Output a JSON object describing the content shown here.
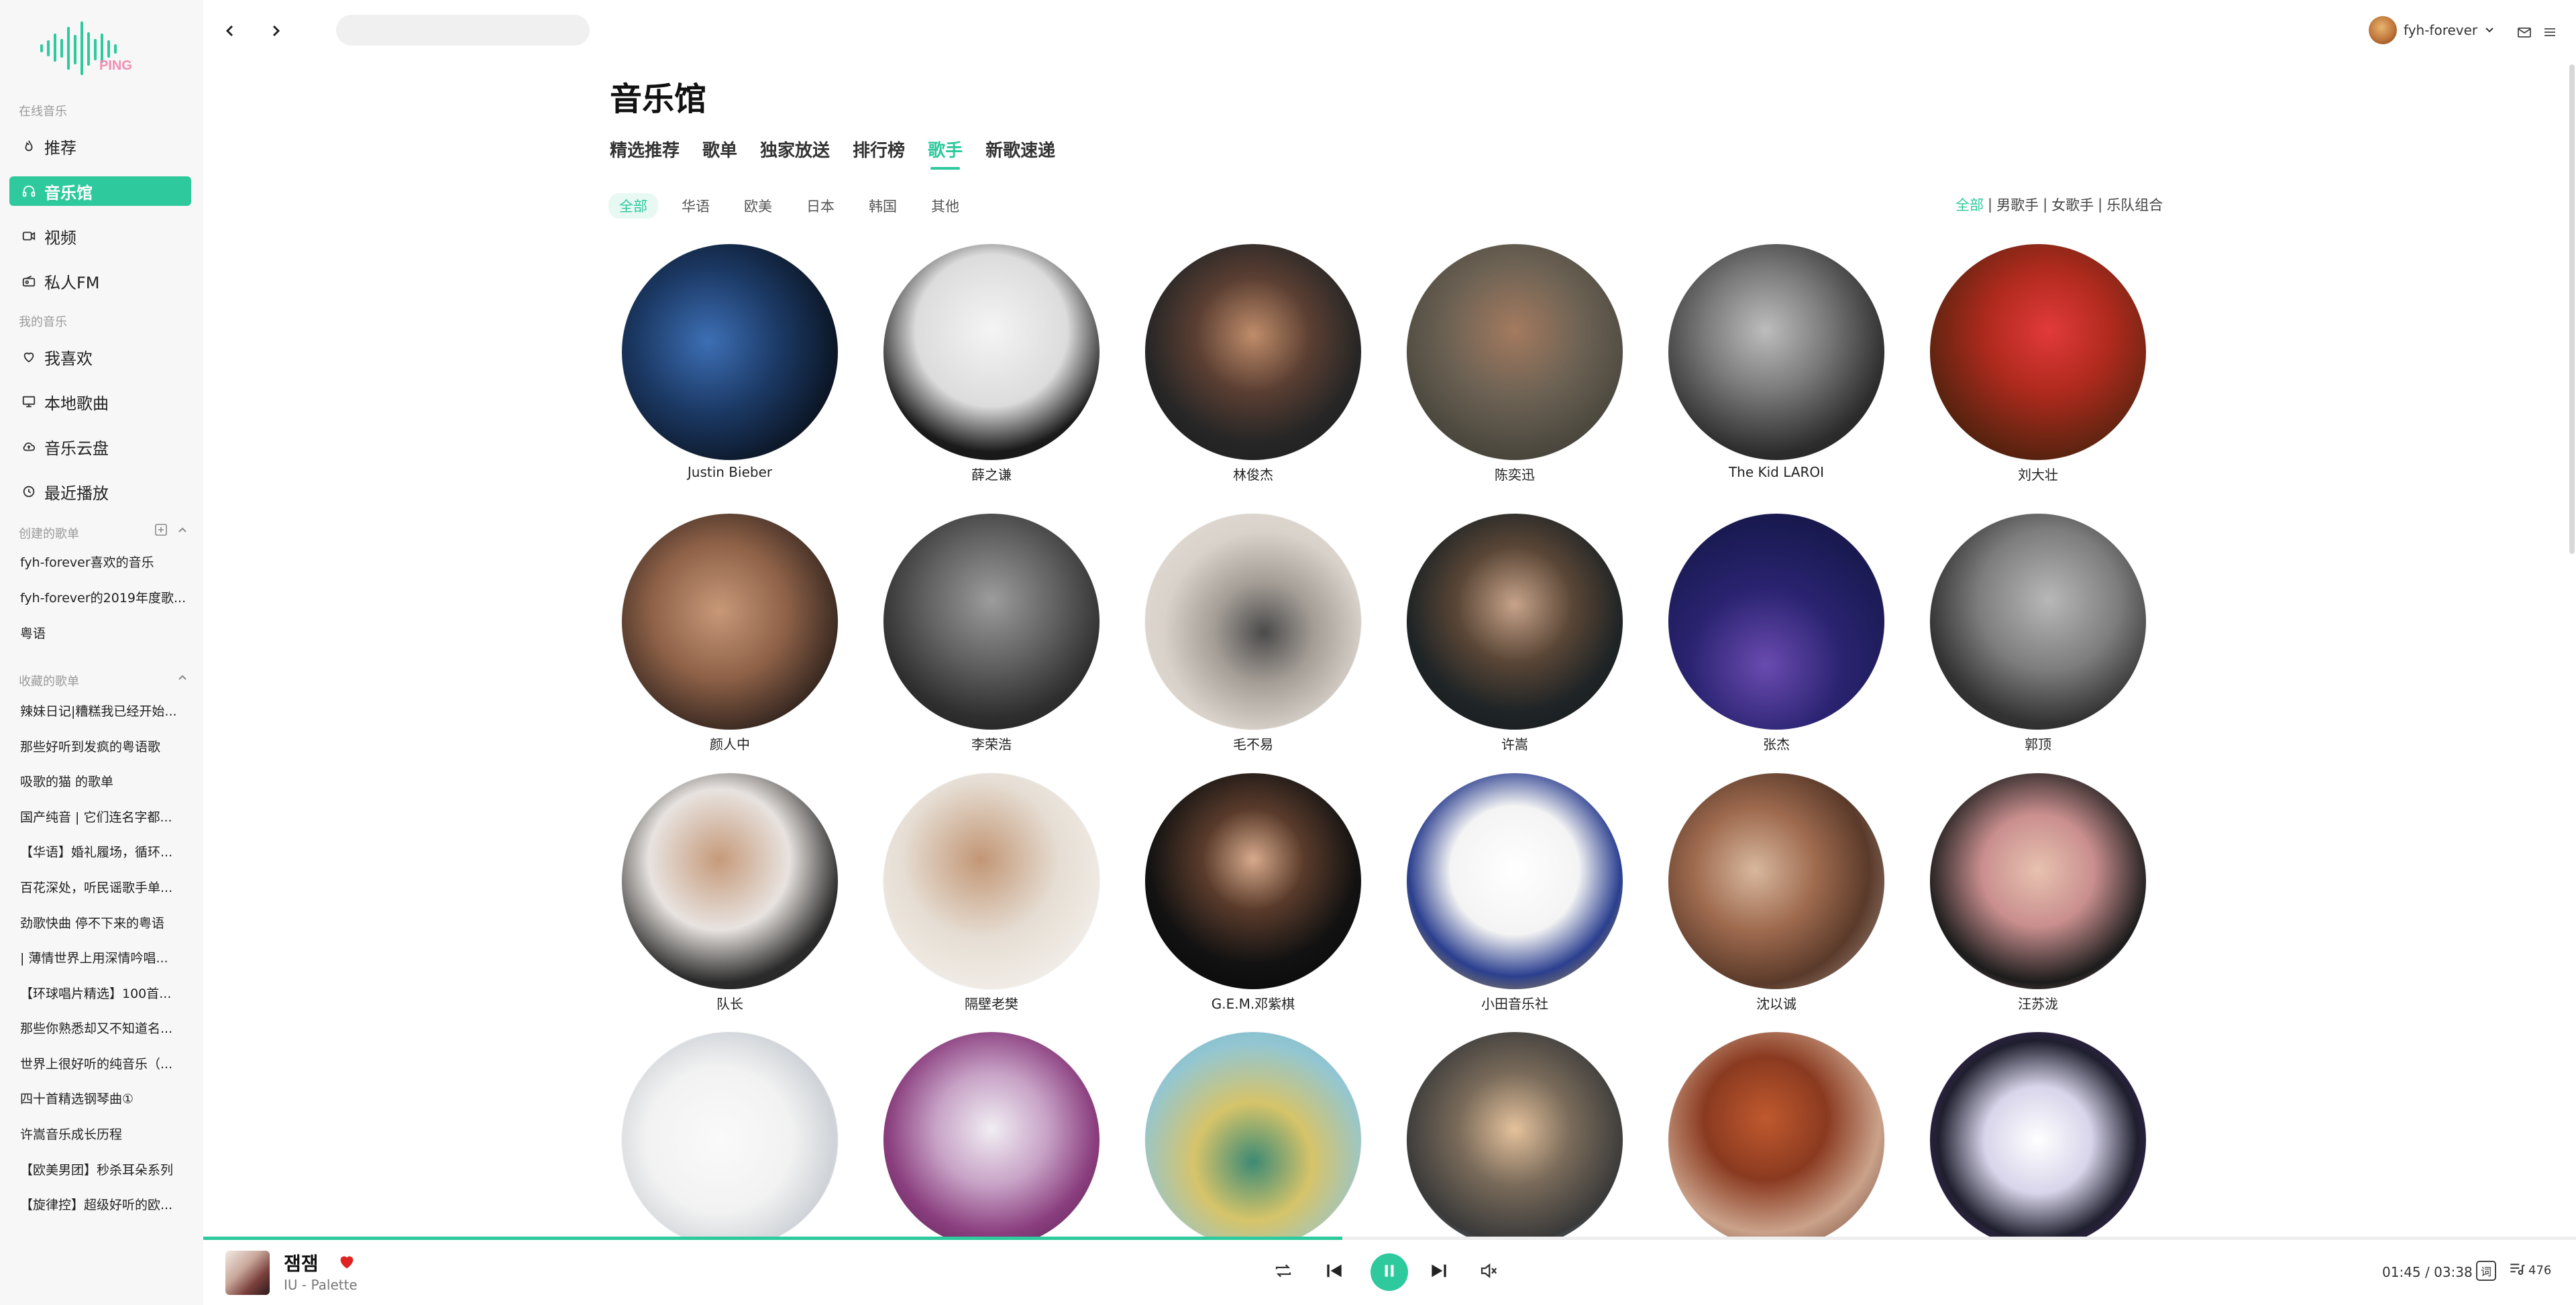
{
  "app": {
    "logo_text": "PING"
  },
  "sidebar": {
    "online_title": "在线音乐",
    "online_items": [
      {
        "label": "推荐",
        "icon": "flame-icon"
      },
      {
        "label": "音乐馆",
        "icon": "headphones-icon",
        "active": true
      },
      {
        "label": "视频",
        "icon": "video-icon"
      },
      {
        "label": "私人FM",
        "icon": "radio-icon"
      }
    ],
    "my_title": "我的音乐",
    "my_items": [
      {
        "label": "我喜欢",
        "icon": "heart-icon"
      },
      {
        "label": "本地歌曲",
        "icon": "monitor-icon"
      },
      {
        "label": "音乐云盘",
        "icon": "cloud-icon"
      },
      {
        "label": "最近播放",
        "icon": "clock-icon"
      }
    ],
    "created_title": "创建的歌单",
    "created": [
      "fyh-forever喜欢的音乐",
      "fyh-forever的2019年度歌...",
      "粤语"
    ],
    "collected_title": "收藏的歌单",
    "collected": [
      "辣妹日记|糟糕我已经开始...",
      "那些好听到发疯的粤语歌",
      "吸歌的猫 的歌单",
      "国产纯音 | 它们连名字都...",
      "【华语】婚礼履场，循环...",
      "百花深处，听民谣歌手单...",
      "劲歌快曲 停不下来的粤语",
      "| 薄情世界上用深情吟唱...",
      "【环球唱片精选】100首...",
      "那些你熟悉却又不知道名...",
      "世界上很好听的纯音乐（...",
      "四十首精选钢琴曲①",
      "许嵩音乐成长历程",
      "【欧美男团】秒杀耳朵系列",
      "【旋律控】超级好听的欧..."
    ]
  },
  "topbar": {
    "search_placeholder": "",
    "username": "fyh-forever"
  },
  "main": {
    "title": "音乐馆",
    "tabs": [
      {
        "label": "精选推荐"
      },
      {
        "label": "歌单"
      },
      {
        "label": "独家放送"
      },
      {
        "label": "排行榜"
      },
      {
        "label": "歌手",
        "active": true
      },
      {
        "label": "新歌速递"
      }
    ],
    "regions": [
      {
        "label": "全部",
        "active": true
      },
      {
        "label": "华语"
      },
      {
        "label": "欧美"
      },
      {
        "label": "日本"
      },
      {
        "label": "韩国"
      },
      {
        "label": "其他"
      }
    ],
    "types": [
      {
        "label": "全部",
        "active": true
      },
      {
        "label": "男歌手"
      },
      {
        "label": "女歌手"
      },
      {
        "label": "乐队组合"
      }
    ],
    "artists": [
      {
        "name": "Justin Bieber",
        "tone": "radial-gradient(circle at 40% 45%, #3d6fb5 0%, #1c3a66 40%, #0b1524 75%, #12a08a 100%)"
      },
      {
        "name": "薛之谦",
        "tone": "radial-gradient(circle at 50% 40%, #f4f4f4 0%, #dcdcdc 45%, #1a1a1a 72%, #111 100%)"
      },
      {
        "name": "林俊杰",
        "tone": "radial-gradient(circle at 50% 42%, #c08d6a 0%, #5a3e32 35%, #262626 65%, #1a1a1a 100%)"
      },
      {
        "name": "陈奕迅",
        "tone": "radial-gradient(circle at 50% 40%, #a47a5f 0%, #6d6254 40%, #4e4a40 70%, #38352e 100%)"
      },
      {
        "name": "The Kid LAROI",
        "tone": "radial-gradient(circle at 45% 40%, #bdbdbd 0%, #7a7a7a 35%, #2d2d2d 70%, #111 100%)"
      },
      {
        "name": "刘大壮",
        "tone": "radial-gradient(circle at 55% 40%, #e23a3a 0%, #b02a1e 35%, #5e2410 70%, #2a1208 100%)"
      },
      {
        "name": "颜人中",
        "tone": "radial-gradient(circle at 45% 45%, #c89878 0%, #8f6248 40%, #3b2a22 72%, #1d1612 100%)"
      },
      {
        "name": "李荣浩",
        "tone": "radial-gradient(circle at 50% 40%, #9c9c9c 0%, #5f5f5f 40%, #2e2e2e 70%, #1c1c1c 100%)"
      },
      {
        "name": "毛不易",
        "tone": "radial-gradient(circle at 55% 55%, #4a4a4a 0%, #a49d96 30%, #d9d2ca 60%, #e6e0d8 100%)"
      },
      {
        "name": "许嵩",
        "tone": "radial-gradient(circle at 50% 42%, #c7a38a 0%, #5a4636 35%, #1f2426 65%, #131718 100%)"
      },
      {
        "name": "张杰",
        "tone": "radial-gradient(circle at 45% 70%, #6a4bb0 0%, #2a2370 40%, #1b1b55 70%, #12123a 100%)"
      },
      {
        "name": "郭顶",
        "tone": "radial-gradient(circle at 55% 40%, #b8b8b8 0%, #7d7d7d 40%, #333 70%, #1c1c1c 100%)"
      },
      {
        "name": "队长",
        "tone": "radial-gradient(circle at 45% 40%, #c59a7a 0%, #e8e3e0 40%, #2b2b2b 70%, #1a1a1a 100%)"
      },
      {
        "name": "隔壁老樊",
        "tone": "radial-gradient(circle at 45% 40%, #c29675 0%, #e6ded4 45%, #f2eee9 80%, #d9d2c9 100%)"
      },
      {
        "name": "G.E.M.邓紫棋",
        "tone": "radial-gradient(circle at 50% 40%, #d7aa8c 0%, #5a3b2b 30%, #121212 62%, #050505 100%)"
      },
      {
        "name": "小田音乐社",
        "tone": "radial-gradient(circle at 50% 45%, #ffffff 0%, #f4f4f4 40%, #2b3f8f 66%, #f6c326 100%)"
      },
      {
        "name": "沈以诚",
        "tone": "radial-gradient(circle at 40% 45%, #d8b89e 0%, #9e6a4e 35%, #5a3a2a 65%, #b8a49a 100%)"
      },
      {
        "name": "汪苏泷",
        "tone": "radial-gradient(circle at 50% 45%, #e8c2b0 0%, #c98e8e 35%, #1c1c1c 70%, #c98f96 100%)"
      },
      {
        "name": "",
        "tone": "radial-gradient(circle at 45% 50%, #fafafa 0%, #f2f2f2 45%, #cfd3d8 72%, #ffffff 100%)"
      },
      {
        "name": "",
        "tone": "radial-gradient(circle at 50% 45%, #f1eef3 0%, #c7a2c6 35%, #8a3e7e 65%, #4b1a47 100%)"
      },
      {
        "name": "",
        "tone": "radial-gradient(circle at 50% 60%, #3c8a74 0%, #d6c46a 35%, #93c6d2 70%, #6fb1c7 100%)"
      },
      {
        "name": "",
        "tone": "radial-gradient(circle at 50% 45%, #e5c29c 0%, #7a6b5a 35%, #3a3a3a 70%, #8fb5d8 100%)"
      },
      {
        "name": "",
        "tone": "radial-gradient(circle at 45% 40%, #c0592e 0%, #8a3a20 35%, #caa28a 65%, #5a2c1e 100%)"
      },
      {
        "name": "",
        "tone": "radial-gradient(circle at 50% 50%, #ffffff 0%, #d8d4ea 35%, #1f1f2e 65%, #5e2a8a 100%)"
      }
    ]
  },
  "player": {
    "song_title": "잼잼",
    "song_artist": "IU - Palette",
    "time": "01:45 / 03:38",
    "progress": 0.48,
    "count": "476",
    "quality": "词"
  },
  "colors": {
    "accent": "#2ec99c",
    "like": "#e02424"
  }
}
